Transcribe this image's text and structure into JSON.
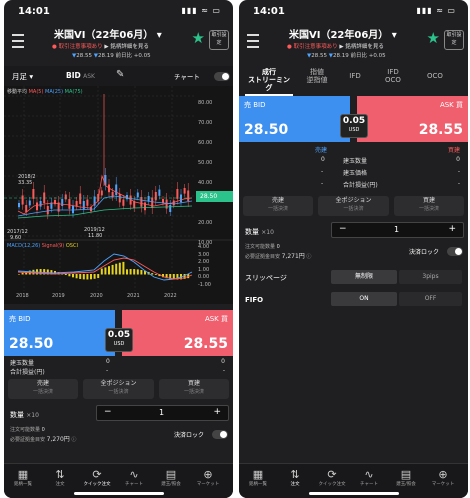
{
  "status": {
    "time": "14:01",
    "icons": "▮▮▮ ≈ ▭"
  },
  "header": {
    "title": "米国VI（22年06月）",
    "warn1": "取引注意事項あり",
    "warn2": "銘柄詳細を見る",
    "price_bid_arrow": "▼",
    "price_bid": "28.55",
    "price_ask_arrow": "▼",
    "price_ask": "28.19",
    "change": "前日比 +0.05",
    "settings_label": "取引設定"
  },
  "p1": {
    "toolbar": {
      "period": "月足",
      "side": "BID",
      "side_sub": "ASK",
      "chart_label": "チャート"
    },
    "legend_main": [
      "移動平均",
      "MA(5)",
      "MA(25)",
      "MA(75)"
    ],
    "legend_sub": [
      "MACD(12,26)",
      "Signal(9)",
      "OSCI"
    ],
    "annotations": {
      "high_date": "2018/2",
      "high_val": "33.35",
      "low_date": "2017/12",
      "low_val": "9.60",
      "low2_date": "2019/12",
      "low2_val": "11.80",
      "current": "28.50"
    },
    "y_main": [
      "80.00",
      "70.00",
      "60.00",
      "50.00",
      "40.00",
      "30.00",
      "20.00",
      "10.00"
    ],
    "y_sub": [
      "4.00",
      "3.00",
      "2.00",
      "1.00",
      "0.00",
      "-1.00"
    ],
    "x_labels": [
      "2018",
      "2019",
      "2020",
      "2021",
      "2022"
    ],
    "bid_label": "売 BID",
    "bid_value": "28.50",
    "ask_label": "ASK 買",
    "ask_value": "28.55",
    "spread_value": "0.05",
    "spread_unit": "USD",
    "rows": [
      {
        "label": "建玉数量",
        "l": "0",
        "r": "0"
      },
      {
        "label": "合計損益(円)",
        "l": "-",
        "r": "-"
      }
    ],
    "buttons": [
      {
        "main": "売建",
        "sub": "一括決済"
      },
      {
        "main": "全ポジション",
        "sub": "一括決済"
      },
      {
        "main": "買建",
        "sub": "一括決済"
      }
    ],
    "qty_label": "数量",
    "qty_mult": "×10",
    "qty_value": "1",
    "minus": "−",
    "plus": "+",
    "margin1": "注文可能数量",
    "margin1_val": "0",
    "margin2": "必要証拠金目安",
    "margin2_val": "7,270円",
    "lock_label": "決済ロック"
  },
  "p2": {
    "tabs": [
      {
        "line1": "成行",
        "line2": "ストリーミング"
      },
      {
        "line1": "指値",
        "line2": "逆指値"
      },
      {
        "line1": "IFD",
        "line2": ""
      },
      {
        "line1": "IFD",
        "line2": "OCO"
      },
      {
        "line1": "OCO",
        "line2": ""
      }
    ],
    "bid_label": "売 BID",
    "bid_value": "28.50",
    "ask_label": "ASK 買",
    "ask_value": "28.55",
    "spread_value": "0.05",
    "spread_unit": "USD",
    "col_sell": "売建",
    "col_buy": "買建",
    "rows": [
      {
        "label": "建玉数量",
        "l": "0",
        "r": "0"
      },
      {
        "label": "建玉価格",
        "l": "-",
        "r": "-"
      },
      {
        "label": "合計損益(円)",
        "l": "-",
        "r": "-"
      }
    ],
    "buttons": [
      {
        "main": "売建",
        "sub": "一括決済"
      },
      {
        "main": "全ポジション",
        "sub": "一括決済"
      },
      {
        "main": "買建",
        "sub": "一括決済"
      }
    ],
    "qty_label": "数量",
    "qty_mult": "×10",
    "qty_value": "1",
    "minus": "−",
    "plus": "+",
    "margin1": "注文可能数量",
    "margin1_val": "0",
    "margin2": "必要証拠金目安",
    "margin2_val": "7,271円",
    "lock_label": "決済ロック",
    "slippage_label": "スリッページ",
    "slippage_opt1": "無制限",
    "slippage_opt2": "3pips",
    "fifo_label": "FIFO",
    "fifo_on": "ON",
    "fifo_off": "OFF"
  },
  "tabbar": [
    {
      "icon": "▦",
      "label": "銘柄一覧"
    },
    {
      "icon": "⇅",
      "label": "注文"
    },
    {
      "icon": "⟳",
      "label": "クイック注文"
    },
    {
      "icon": "∿",
      "label": "チャート"
    },
    {
      "icon": "▤",
      "label": "建玉/照会"
    },
    {
      "icon": "⊕",
      "label": "マーケット"
    }
  ],
  "colors": {
    "bid": "#3d8ff0",
    "ask": "#ef5f6e",
    "ma5": "#ff5a5a",
    "ma25": "#4da3ff",
    "ma75": "#2cc28b",
    "macd": "#4da3ff",
    "signal": "#ff5a5a",
    "osci": "#e6d31e"
  }
}
